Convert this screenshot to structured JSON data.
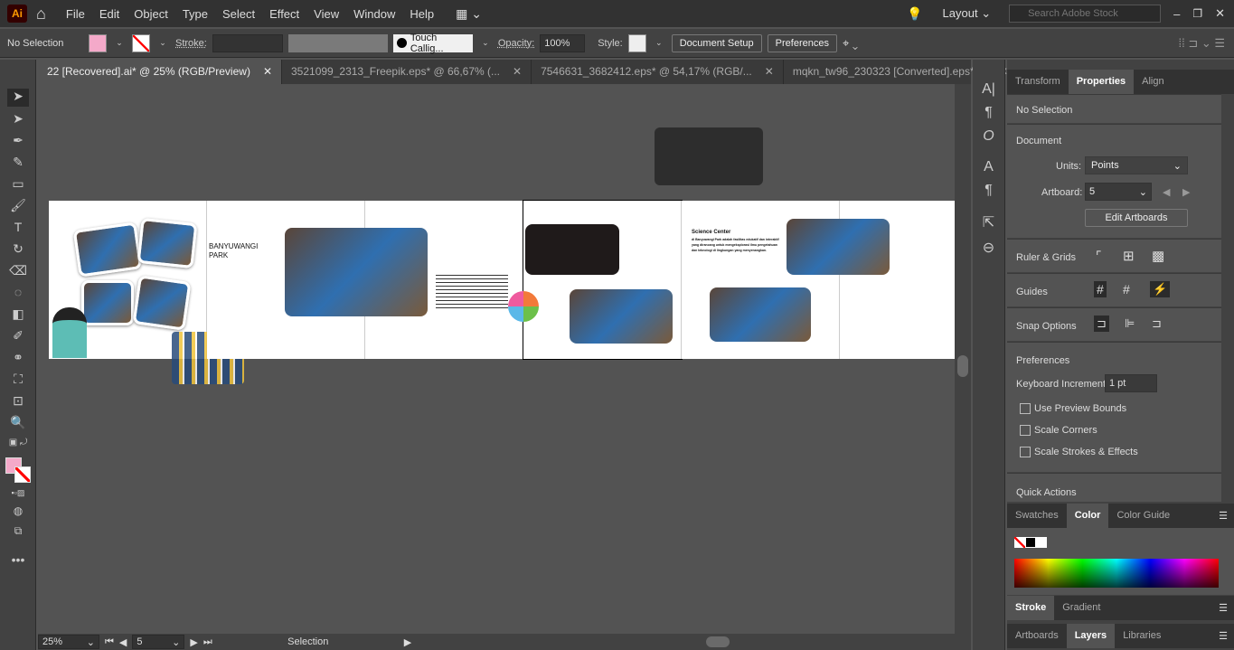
{
  "menubar": {
    "app_icon": "Ai",
    "items": [
      "File",
      "Edit",
      "Object",
      "Type",
      "Select",
      "Effect",
      "View",
      "Window",
      "Help"
    ],
    "workspace": "Layout",
    "search_placeholder": "Search Adobe Stock"
  },
  "control": {
    "selection": "No Selection",
    "fill_color": "#f4a9c9",
    "stroke_label": "Stroke:",
    "brush": "Touch Callig...",
    "opacity_label": "Opacity:",
    "opacity": "100%",
    "style_label": "Style:",
    "document_setup": "Document Setup",
    "preferences": "Preferences"
  },
  "tabs": [
    {
      "label": "22 [Recovered].ai* @ 25% (RGB/Preview)",
      "active": true
    },
    {
      "label": "3521099_2313_Freepik.eps* @ 66,67% (..."
    },
    {
      "label": "7546631_3682412.eps* @ 54,17% (RGB/..."
    },
    {
      "label": "mqkn_tw96_230323 [Converted].eps* ..."
    }
  ],
  "artboard": {
    "title_banyuwangi": "BANYUWANGI PARK",
    "science_title": "Science Center",
    "science_text": "di Banyuwangi Park adalah fasilitas edukatif dan interaktif yang dirancang untuk mengeksplorasi ilmu pengetahuan dan teknologi di lingkungan yang menyenangkan."
  },
  "panel": {
    "tabs": [
      "Transform",
      "Properties",
      "Align"
    ],
    "no_selection": "No Selection",
    "document": "Document",
    "units_label": "Units:",
    "units": "Points",
    "artboard_label": "Artboard:",
    "artboard": "5",
    "edit_artboards": "Edit Artboards",
    "ruler_grids": "Ruler & Grids",
    "guides": "Guides",
    "snap": "Snap Options",
    "preferences": "Preferences",
    "kb_label": "Keyboard Increment:",
    "kb": "1 pt",
    "use_preview": "Use Preview Bounds",
    "scale_corners": "Scale Corners",
    "scale_strokes": "Scale Strokes & Effects",
    "quick_actions": "Quick Actions",
    "color_tabs": [
      "Swatches",
      "Color",
      "Color Guide"
    ],
    "stroke_tabs": [
      "Stroke",
      "Gradient"
    ],
    "layer_tabs": [
      "Artboards",
      "Layers",
      "Libraries"
    ]
  },
  "status": {
    "zoom": "25%",
    "artboard": "5",
    "tool": "Selection"
  }
}
